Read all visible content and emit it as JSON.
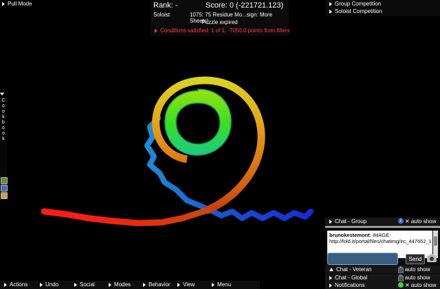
{
  "pull_mode": "Pull Mode",
  "score_panel": {
    "rank_label": "Rank: -",
    "score_label": "Score:  0 (-221721.123)",
    "mode": "Soloist",
    "puzzle_name": "1075: 75 Residue Mo...sign: More Sheets!",
    "status": "Puzzle expired",
    "conditions": "Conditions satisfied: 1 of 1, -7050.0 points from filters"
  },
  "competitions": [
    "Group Competition",
    "Soloist Competition"
  ],
  "cookbook": {
    "label": "Cookbook"
  },
  "chat": {
    "group_tab": "Chat - Group",
    "auto_show": "auto show",
    "log_user": "brunokestemont",
    "log_text": ": IMAGE: http://fold.it/portal/files/chatimg/irc_447652_1",
    "send_label": "Send",
    "rows": [
      {
        "label": "Chat - Veteran",
        "auto": "auto show"
      },
      {
        "label": "Chat - Global",
        "auto": "auto show"
      },
      {
        "label": "Notifications",
        "auto": "auto show"
      }
    ]
  },
  "bottom_menu": [
    "Actions",
    "Undo",
    "Social",
    "Modes",
    "Behavior",
    "View",
    "Menu"
  ],
  "colors": {
    "accent_red": "#ff3b3b",
    "input_blue": "#3a5d80"
  }
}
